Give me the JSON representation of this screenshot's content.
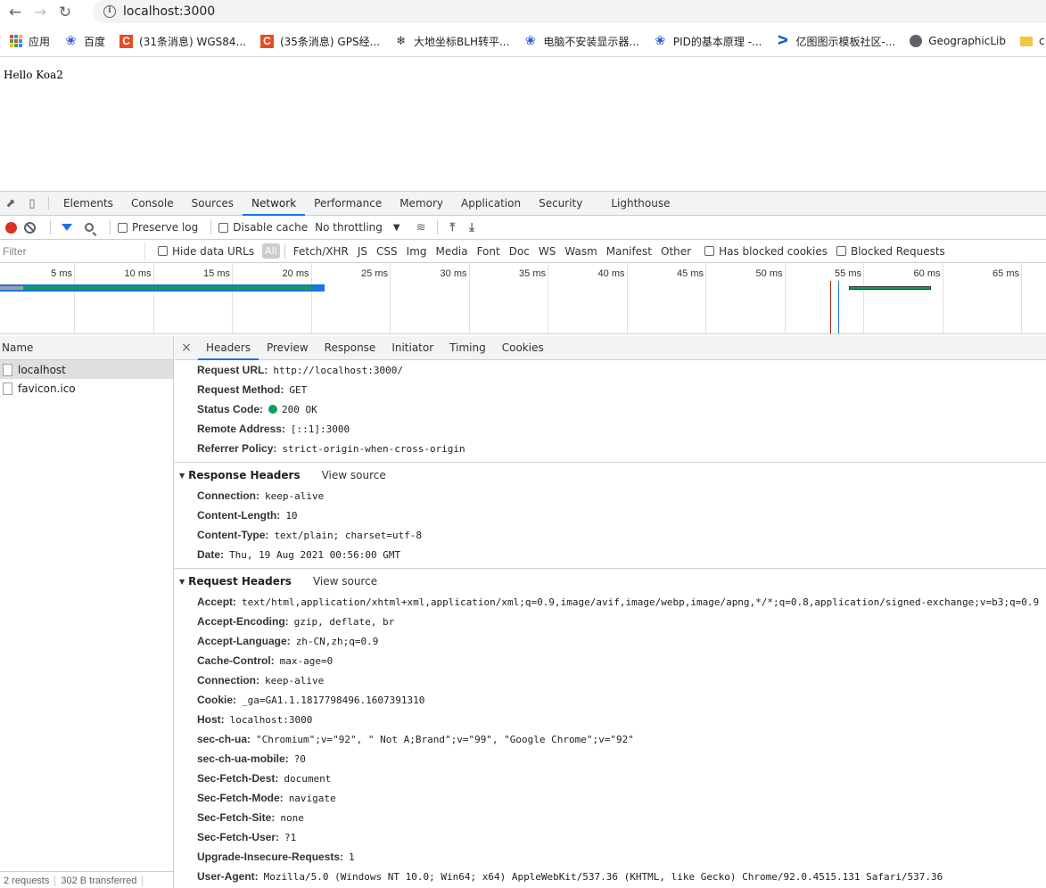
{
  "browser": {
    "url": "localhost:3000",
    "bookmarks": [
      {
        "label": "应用",
        "icon": "apps-grid-icon"
      },
      {
        "label": "百度",
        "icon": "baidu-paw-icon"
      },
      {
        "label": "(31条消息) WGS84...",
        "icon": "csdn-c-icon"
      },
      {
        "label": "(35条消息) GPS经...",
        "icon": "csdn-c-icon"
      },
      {
        "label": "大地坐标BLH转平...",
        "icon": "ant-icon"
      },
      {
        "label": "电脑不安装显示器...",
        "icon": "baidu-paw-icon"
      },
      {
        "label": "PID的基本原理 -...",
        "icon": "baidu-paw-icon"
      },
      {
        "label": "亿图图示模板社区-...",
        "icon": "yitu-icon"
      },
      {
        "label": "GeographicLib",
        "icon": "globe-icon"
      },
      {
        "label": "c",
        "icon": "folder-icon"
      }
    ]
  },
  "page": {
    "content": "Hello Koa2"
  },
  "devtools": {
    "tabs": [
      "Elements",
      "Console",
      "Sources",
      "Network",
      "Performance",
      "Memory",
      "Application",
      "Security",
      "Lighthouse"
    ],
    "active_tab": "Network",
    "toolbar": {
      "preserve_log": "Preserve log",
      "disable_cache": "Disable cache",
      "throttling": "No throttling"
    },
    "filter": {
      "placeholder": "Filter",
      "hide_data_urls": "Hide data URLs",
      "types": [
        "All",
        "Fetch/XHR",
        "JS",
        "CSS",
        "Img",
        "Media",
        "Font",
        "Doc",
        "WS",
        "Wasm",
        "Manifest",
        "Other"
      ],
      "has_blocked_cookies": "Has blocked cookies",
      "blocked_requests": "Blocked Requests"
    },
    "overview_ticks": [
      "5 ms",
      "10 ms",
      "15 ms",
      "20 ms",
      "25 ms",
      "30 ms",
      "35 ms",
      "40 ms",
      "45 ms",
      "50 ms",
      "55 ms",
      "60 ms",
      "65 ms"
    ],
    "requests": {
      "header": "Name",
      "items": [
        "localhost",
        "favicon.ico"
      ],
      "footer_requests": "2 requests",
      "footer_transferred": "302 B transferred"
    },
    "details": {
      "tabs": [
        "Headers",
        "Preview",
        "Response",
        "Initiator",
        "Timing",
        "Cookies"
      ],
      "active_tab": "Headers",
      "general": [
        {
          "name": "Request URL:",
          "value": "http://localhost:3000/"
        },
        {
          "name": "Request Method:",
          "value": "GET"
        },
        {
          "name": "Status Code:",
          "value": "200 OK"
        },
        {
          "name": "Remote Address:",
          "value": "[::1]:3000"
        },
        {
          "name": "Referrer Policy:",
          "value": "strict-origin-when-cross-origin"
        }
      ],
      "response_headers": {
        "title": "Response Headers",
        "view_source": "View source",
        "rows": [
          {
            "name": "Connection:",
            "value": "keep-alive"
          },
          {
            "name": "Content-Length:",
            "value": "10"
          },
          {
            "name": "Content-Type:",
            "value": "text/plain; charset=utf-8"
          },
          {
            "name": "Date:",
            "value": "Thu, 19 Aug 2021 00:56:00 GMT"
          }
        ]
      },
      "request_headers": {
        "title": "Request Headers",
        "view_source": "View source",
        "rows": [
          {
            "name": "Accept:",
            "value": "text/html,application/xhtml+xml,application/xml;q=0.9,image/avif,image/webp,image/apng,*/*;q=0.8,application/signed-exchange;v=b3;q=0.9"
          },
          {
            "name": "Accept-Encoding:",
            "value": "gzip, deflate, br"
          },
          {
            "name": "Accept-Language:",
            "value": "zh-CN,zh;q=0.9"
          },
          {
            "name": "Cache-Control:",
            "value": "max-age=0"
          },
          {
            "name": "Connection:",
            "value": "keep-alive"
          },
          {
            "name": "Cookie:",
            "value": "_ga=GA1.1.1817798496.1607391310"
          },
          {
            "name": "Host:",
            "value": "localhost:3000"
          },
          {
            "name": "sec-ch-ua:",
            "value": "\"Chromium\";v=\"92\", \" Not A;Brand\";v=\"99\", \"Google Chrome\";v=\"92\""
          },
          {
            "name": "sec-ch-ua-mobile:",
            "value": "?0"
          },
          {
            "name": "Sec-Fetch-Dest:",
            "value": "document"
          },
          {
            "name": "Sec-Fetch-Mode:",
            "value": "navigate"
          },
          {
            "name": "Sec-Fetch-Site:",
            "value": "none"
          },
          {
            "name": "Sec-Fetch-User:",
            "value": "?1"
          },
          {
            "name": "Upgrade-Insecure-Requests:",
            "value": "1"
          },
          {
            "name": "User-Agent:",
            "value": "Mozilla/5.0 (Windows NT 10.0; Win64; x64) AppleWebKit/537.36 (KHTML, like Gecko) Chrome/92.0.4515.131 Safari/537.36"
          }
        ]
      }
    }
  },
  "colors": {
    "accent": "#1a73e8",
    "record": "#d93025",
    "status_ok": "#0f9d58"
  }
}
